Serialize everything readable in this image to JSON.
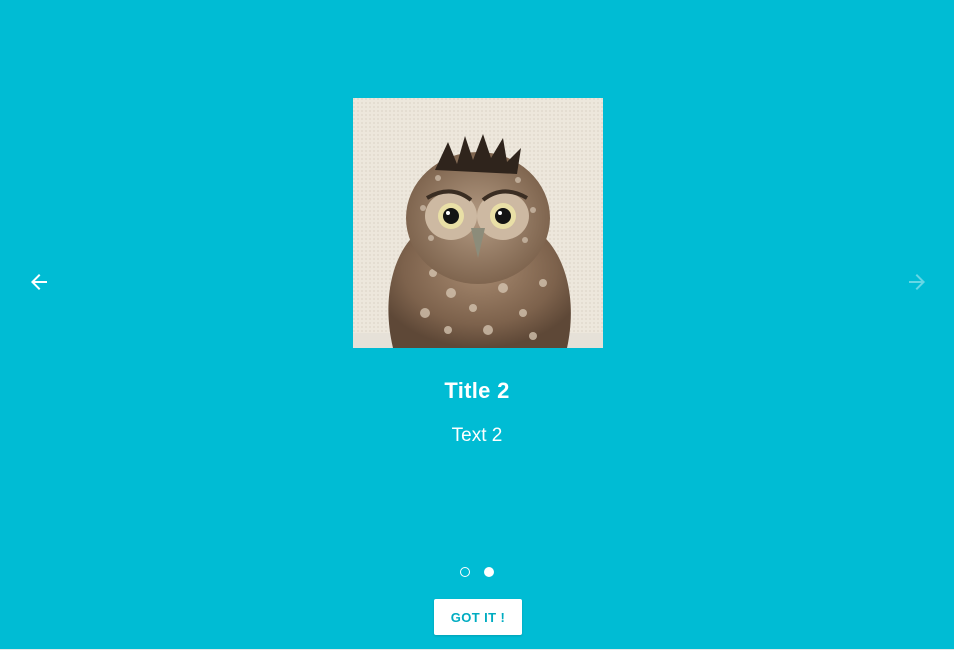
{
  "theme": {
    "background": "#00bcd4",
    "button_text": "#00acc1",
    "foreground": "#ffffff"
  },
  "navigation": {
    "prev_icon": "arrow-left-icon",
    "next_icon": "arrow-right-icon",
    "next_disabled": true
  },
  "slide": {
    "image_icon": "owl-photo",
    "title": "Title 2",
    "text": "Text 2"
  },
  "pager": {
    "total": 2,
    "current": 2
  },
  "done_button": {
    "label": "GOT IT !"
  }
}
